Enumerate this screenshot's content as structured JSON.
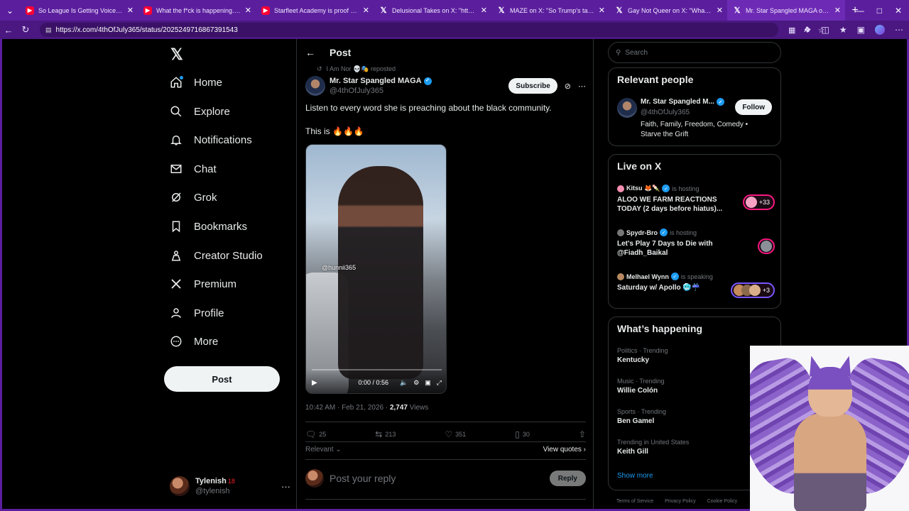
{
  "browser": {
    "tabs": [
      {
        "title": "So League Is Getting Voice Chat...",
        "icon": "youtube-icon",
        "active": false
      },
      {
        "title": "What the f*ck is happening.. - You",
        "icon": "youtube-icon",
        "active": false
      },
      {
        "title": "Starfleet Academy is proof Hollyw",
        "icon": "youtube-icon",
        "active": false
      },
      {
        "title": "Delusional Takes on X: \"https://t.c",
        "icon": "x-icon",
        "active": false
      },
      {
        "title": "MAZE on X: \"So Trump's tariffs an",
        "icon": "x-icon",
        "active": false
      },
      {
        "title": "Gay Not Queer on X: \"What a not",
        "icon": "x-icon",
        "active": false
      },
      {
        "title": "Mr. Star Spangled MAGA on X: \"Li",
        "icon": "x-icon",
        "active": true
      }
    ],
    "url": "https://x.com/4thOfJuly365/status/2025249716867391543",
    "accent": "#5b1f9e"
  },
  "nav": {
    "items": [
      {
        "label": "Home",
        "icon": "home-icon"
      },
      {
        "label": "Explore",
        "icon": "search-icon"
      },
      {
        "label": "Notifications",
        "icon": "bell-icon"
      },
      {
        "label": "Chat",
        "icon": "mail-icon"
      },
      {
        "label": "Grok",
        "icon": "grok-icon"
      },
      {
        "label": "Bookmarks",
        "icon": "bookmark-icon"
      },
      {
        "label": "Creator Studio",
        "icon": "creator-icon"
      },
      {
        "label": "Premium",
        "icon": "x-logo-icon"
      },
      {
        "label": "Profile",
        "icon": "person-icon"
      },
      {
        "label": "More",
        "icon": "more-circle-icon"
      }
    ],
    "post_button": "Post",
    "account": {
      "name": "Tylenish",
      "badge": "18",
      "handle": "@tylenish",
      "more": "···"
    }
  },
  "post": {
    "header_title": "Post",
    "reposted_by": "I Am Nor 💀🎭 reposted",
    "author_name": "Mr. Star Spangled MAGA",
    "author_handle": "@4thOfJuly365",
    "subscribe_label": "Subscribe",
    "text_line1": "Listen to every word she is preaching about the black community.",
    "text_line2": "This is 🔥🔥🔥",
    "video": {
      "watermark": "@hunnii365",
      "time": "0:00 / 0:56"
    },
    "timestamp": "10:42 AM · Feb 21, 2026 · ",
    "views_count": "2,747",
    "views_label": " Views",
    "replies": "25",
    "reposts": "213",
    "likes": "351",
    "bookmarks": "30",
    "relevant_label": "Relevant",
    "view_quotes": "View quotes",
    "reply_placeholder": "Post your reply",
    "reply_button": "Reply"
  },
  "sidebar": {
    "search_placeholder": "Search",
    "relevant_people": {
      "title": "Relevant people",
      "name": "Mr. Star Spangled M...",
      "handle": "@4thOfJuly365",
      "follow_label": "Follow",
      "bio": "Faith, Family, Freedom, Comedy • Starve the Grift"
    },
    "live": {
      "title": "Live on X",
      "items": [
        {
          "host": "Kitsu 🦊🍡",
          "status": "is hosting",
          "title": "ALOO WE FARM REACTIONS TODAY  (2 days before hiatus)...",
          "badge": "+33"
        },
        {
          "host": "Spydr-Bro",
          "status": "is hosting",
          "title": "Let's Play 7 Days to Die with @Fiadh_Baikal",
          "badge": ""
        },
        {
          "host": "Melhael Wynn",
          "status": "is speaking",
          "title": "Saturday w/ Apollo 🥶☔",
          "badge": "+3"
        }
      ]
    },
    "trending": {
      "title": "What’s happening",
      "items": [
        {
          "category": "Politics · Trending",
          "name": "Kentucky"
        },
        {
          "category": "Music · Trending",
          "name": "Willie Colón"
        },
        {
          "category": "Sports · Trending",
          "name": "Ben Gamel"
        },
        {
          "category": "Trending in United States",
          "name": "Keith Gill"
        }
      ],
      "show_more": "Show more"
    },
    "footer": [
      "Terms of Service",
      "Privacy Policy",
      "Cookie Policy"
    ]
  }
}
